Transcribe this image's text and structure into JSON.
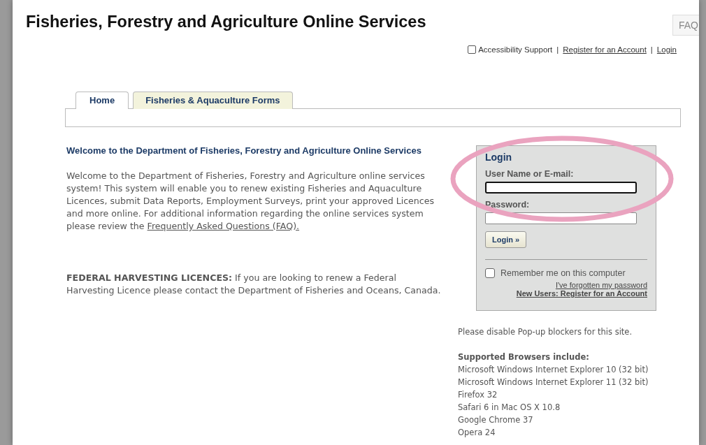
{
  "header": {
    "title": "Fisheries, Forestry and Agriculture Online Services",
    "faq_button": "FAQ"
  },
  "top_links": {
    "accessibility": {
      "label": "Accessibility Support",
      "checked": false
    },
    "separator_1": "|",
    "register": "Register for an Account",
    "separator_2": "|",
    "login": "Login"
  },
  "tabs": [
    {
      "label": "Home",
      "selected": true
    },
    {
      "label": "Fisheries & Aquaculture Forms",
      "selected": false
    }
  ],
  "welcome": {
    "heading": "Welcome to the Department of Fisheries, Forestry and Agriculture Online Services",
    "body": "Welcome to the Department of Fisheries, Forestry and Agriculture online services system! This system will enable you to renew existing Fisheries and Aquaculture Licences, submit Data Reports, Employment Surveys, print your approved Licences and more online. For additional information regarding the online services system please review the",
    "link": "Frequently Asked Questions (FAQ)."
  },
  "federal_notice": "**FEDERAL HARVESTING LICENCES:** If you are looking to renew a Federal Harvesting Licence please contact the Department of Fisheries and Oceans, Canada.",
  "login": {
    "title": "Login",
    "fields": [
      {
        "label": "User Name or E-mail:",
        "focused": true
      },
      {
        "label": "Password:",
        "focused": false
      }
    ],
    "button": "Login »",
    "remember": {
      "label": "Remember me on this computer",
      "checked": false
    },
    "forgot_link": "I've forgotten my password",
    "register_link": "New Users: Register for an Account"
  },
  "popup_note": "Please disable Pop-up blockers for this site.",
  "browsers": {
    "heading": "Supported Browsers include:",
    "items": [
      "Microsoft Windows Internet Explorer 10 (32 bit)",
      "Microsoft Windows Internet Explorer 11 (32 bit)",
      "Firefox 32",
      "Safari 6 in Mac OS X 10.8",
      "Google Chrome 37",
      "Opera 24"
    ]
  },
  "annotation": {
    "kind": "ellipse"
  }
}
